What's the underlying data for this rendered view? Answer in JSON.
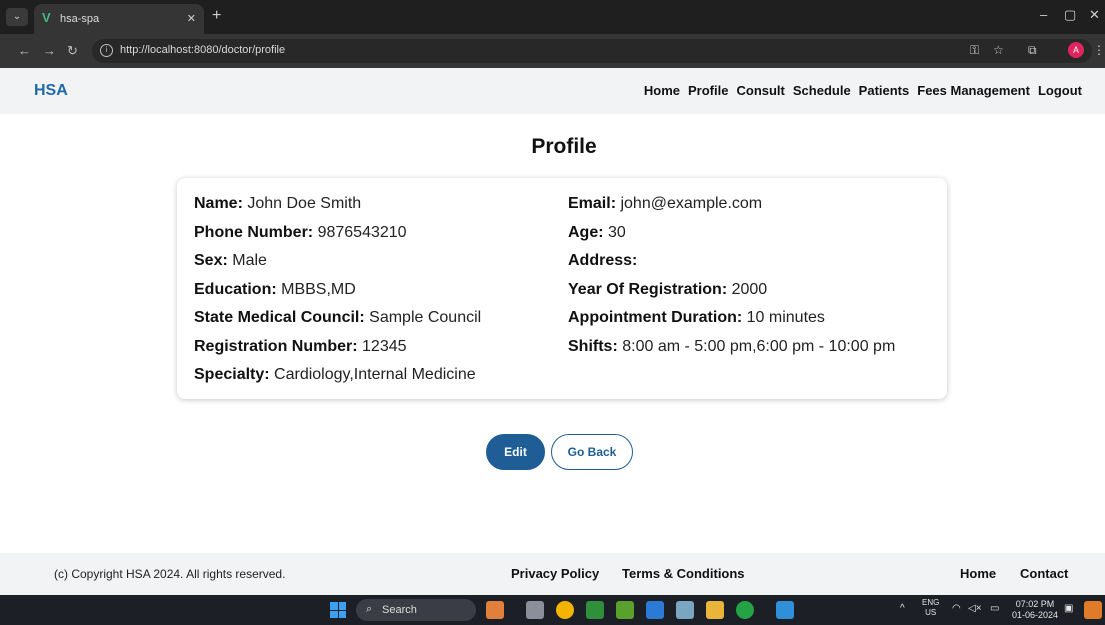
{
  "browser": {
    "tab_title": "hsa-spa",
    "url": "http://localhost:8080/doctor/profile",
    "avatar_letter": "A"
  },
  "nav": {
    "brand": "HSA",
    "links": [
      "Home",
      "Profile",
      "Consult",
      "Schedule",
      "Patients",
      "Fees Management",
      "Logout"
    ]
  },
  "page": {
    "title": "Profile",
    "left_fields": [
      {
        "label": "Name:",
        "value": "John Doe Smith"
      },
      {
        "label": "Phone Number:",
        "value": "9876543210"
      },
      {
        "label": "Sex:",
        "value": "Male"
      },
      {
        "label": "Education:",
        "value": "MBBS,MD"
      },
      {
        "label": "State Medical Council:",
        "value": "Sample Council"
      },
      {
        "label": "Registration Number:",
        "value": "12345"
      },
      {
        "label": "Specialty:",
        "value": "Cardiology,Internal Medicine"
      }
    ],
    "right_fields": [
      {
        "label": "Email:",
        "value": "john@example.com"
      },
      {
        "label": "Age:",
        "value": "30"
      },
      {
        "label": "Address:",
        "value": ""
      },
      {
        "label": "Year Of Registration:",
        "value": "2000"
      },
      {
        "label": "Appointment Duration:",
        "value": "10 minutes"
      },
      {
        "label": "Shifts:",
        "value": "8:00 am - 5:00 pm,6:00 pm - 10:00 pm"
      }
    ],
    "edit_label": "Edit",
    "back_label": "Go Back"
  },
  "footer": {
    "copyright": "(c) Copyright HSA 2024. All rights reserved.",
    "privacy": "Privacy Policy",
    "terms": "Terms & Conditions",
    "home": "Home",
    "contact": "Contact"
  },
  "taskbar": {
    "search_label": "Search",
    "lang_top": "ENG",
    "lang_bottom": "US",
    "time": "07:02 PM",
    "date": "01-06-2024"
  },
  "colors": {
    "brand": "#1e6aa8",
    "primary_button": "#1e5d96"
  }
}
